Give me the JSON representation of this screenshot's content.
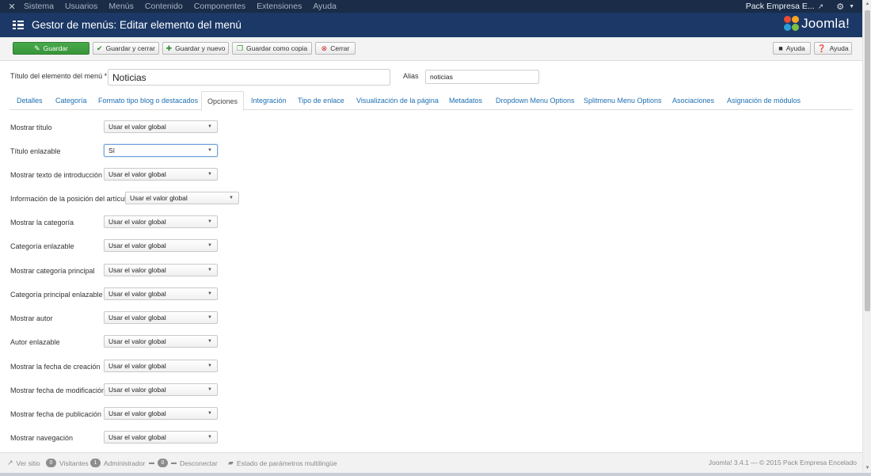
{
  "topnav": {
    "menu": [
      "Sistema",
      "Usuarios",
      "Menús",
      "Contenido",
      "Componentes",
      "Extensiones",
      "Ayuda"
    ],
    "site_name": "Pack Empresa E..."
  },
  "header": {
    "title": "Gestor de menús: Editar elemento del menú",
    "brand": "Joomla!"
  },
  "toolbar": {
    "save": "Guardar",
    "save_close": "Guardar y cerrar",
    "save_new": "Guardar y nuevo",
    "save_copy": "Guardar como copia",
    "close": "Cerrar",
    "help1": "Ayuda",
    "help2": "Ayuda"
  },
  "form": {
    "title_label": "Título del elemento del menú *",
    "title_value": "Noticias",
    "alias_label": "Alias",
    "alias_value": "noticias"
  },
  "tabs": [
    "Detalles",
    "Categoría",
    "Formato tipo blog o destacados",
    "Opciones",
    "Integración",
    "Tipo de enlace",
    "Visualización de la página",
    "Metadatos",
    "Dropdown Menu Options",
    "Splitmenu Menu Options",
    "Asociaciones",
    "Asignación de módulos"
  ],
  "active_tab": "Opciones",
  "options": [
    {
      "label": "Mostrar título",
      "value": "Usar el valor global"
    },
    {
      "label": "Título enlazable",
      "value": "Sí"
    },
    {
      "label": "Mostrar texto de introducción",
      "value": "Usar el valor global"
    },
    {
      "label": "Información de la posición del artículo",
      "value": "Usar el valor global"
    },
    {
      "label": "Mostrar la categoría",
      "value": "Usar el valor global"
    },
    {
      "label": "Categoría enlazable",
      "value": "Usar el valor global"
    },
    {
      "label": "Mostrar categoría principal",
      "value": "Usar el valor global"
    },
    {
      "label": "Categoría principal enlazable",
      "value": "Usar el valor global"
    },
    {
      "label": "Mostrar autor",
      "value": "Usar el valor global"
    },
    {
      "label": "Autor enlazable",
      "value": "Usar el valor global"
    },
    {
      "label": "Mostrar la fecha de creación",
      "value": "Usar el valor global"
    },
    {
      "label": "Mostrar fecha de modificación",
      "value": "Usar el valor global"
    },
    {
      "label": "Mostrar fecha de publicación",
      "value": "Usar el valor global"
    },
    {
      "label": "Mostrar navegación",
      "value": "Usar el valor global"
    }
  ],
  "footer": {
    "view_site": "Ver sitio",
    "visitors_count": "0",
    "visitors": "Visitantes",
    "admin_count": "1",
    "admin": "Administrador",
    "logout_count": "0",
    "logout": "Desconectar",
    "multilang": "Estado de parámetros multilingüe",
    "version": "Joomla! 3.4.1 — © 2015 Pack Empresa Encelado"
  },
  "colors": {
    "topnav": "#1a2c47",
    "header": "#1b3866",
    "save_button": "#46a546",
    "link": "#1f6fb2"
  }
}
